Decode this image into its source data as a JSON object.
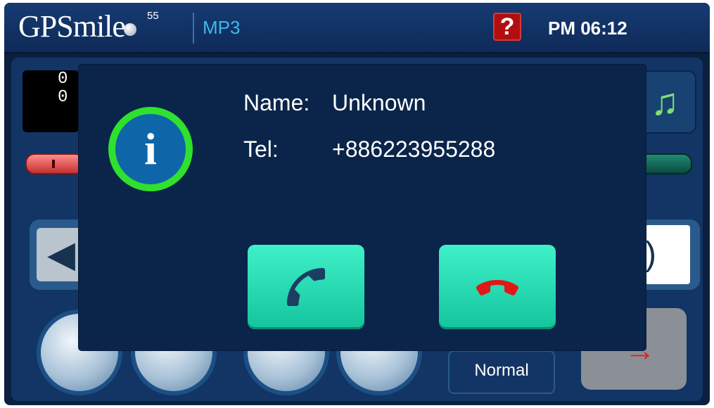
{
  "header": {
    "logo_text": "GPSmile",
    "logo_version": "55",
    "app_title": "MP3",
    "help_label": "?",
    "clock": "PM 06:12"
  },
  "player": {
    "counter_top": "0",
    "counter_bottom": "0",
    "mode_label": "Normal",
    "icons": {
      "music": "music-note-icon",
      "speaker": "speaker-icon",
      "play": "play-icon",
      "stop": "stop-icon",
      "prev": "previous-icon",
      "next": "next-icon",
      "swap": "swap-icon"
    }
  },
  "dialog": {
    "name_label": "Name:",
    "name_value": "Unknown",
    "tel_label": "Tel:",
    "tel_value": "+886223955288",
    "info_glyph": "i",
    "icons": {
      "answer": "phone-answer-icon",
      "decline": "phone-hangup-icon",
      "info": "info-icon"
    },
    "colors": {
      "button": "#22dcb2",
      "info_ring": "#2fe12e",
      "decline_icon": "#e01818",
      "answer_icon": "#1c3e63"
    }
  }
}
